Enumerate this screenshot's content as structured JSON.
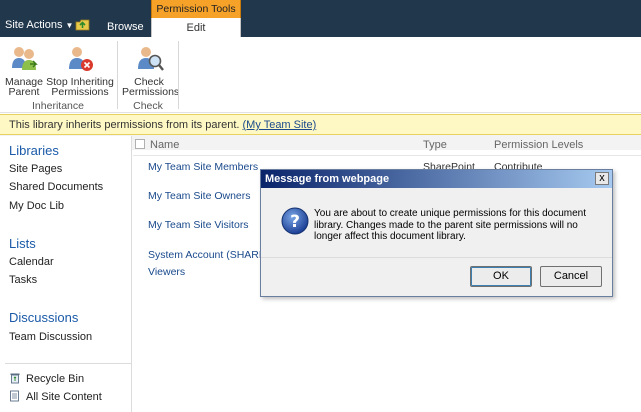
{
  "topbar": {
    "site_actions": "Site Actions",
    "browse_tab": "Browse",
    "context_group": "Permission Tools",
    "edit_tab": "Edit"
  },
  "ribbon": {
    "buttons": [
      {
        "line1": "Manage",
        "line2": "Parent",
        "icon": "manage-parent-icon"
      },
      {
        "line1": "Stop Inheriting",
        "line2": "Permissions",
        "icon": "stop-inheriting-icon"
      },
      {
        "line1": "Check",
        "line2": "Permissions",
        "icon": "check-permissions-icon"
      }
    ],
    "groups": [
      "Inheritance",
      "Check"
    ]
  },
  "notice": {
    "text": "This library inherits permissions from its parent. ",
    "link": "(My Team Site)"
  },
  "quicklaunch": {
    "libraries_heading": "Libraries",
    "libraries": [
      "Site Pages",
      "Shared Documents",
      "My Doc Lib"
    ],
    "lists_heading": "Lists",
    "lists": [
      "Calendar",
      "Tasks"
    ],
    "discussions_heading": "Discussions",
    "discussions": [
      "Team Discussion"
    ],
    "recycle_bin": "Recycle Bin",
    "all_site_content": "All Site Content"
  },
  "list": {
    "columns": {
      "name": "Name",
      "type": "Type",
      "permission": "Permission Levels"
    },
    "rows": [
      {
        "name": "My Team Site Members",
        "type": "SharePoint",
        "permission": "Contribute"
      },
      {
        "name": "My Team Site Owners",
        "type": "",
        "permission": ""
      },
      {
        "name": "My Team Site Visitors",
        "type": "",
        "permission": ""
      },
      {
        "name": "System Account (SHAREPO",
        "type": "",
        "permission": ""
      },
      {
        "name": "Viewers",
        "type": "",
        "permission": ""
      }
    ]
  },
  "dialog": {
    "title": "Message from webpage",
    "close": "x",
    "message": "You are about to create unique permissions for this document library. Changes made to the parent site permissions will no longer affect this document library.",
    "ok": "OK",
    "cancel": "Cancel"
  },
  "colors": {
    "topbar": "#21374c",
    "context_tab": "#f6a128",
    "notice_bg": "#fef8c4",
    "link": "#1a4a8c",
    "heading": "#1a5aa8"
  }
}
